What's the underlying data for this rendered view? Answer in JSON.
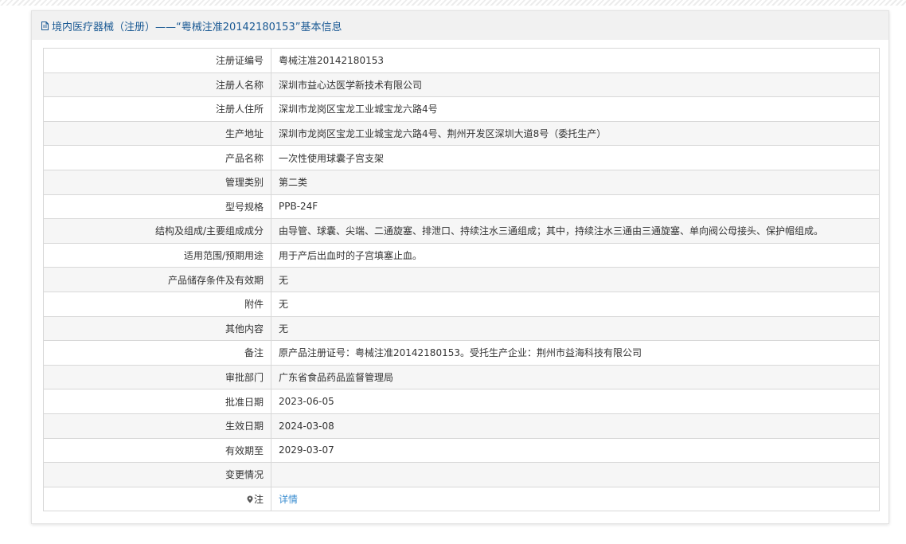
{
  "header": {
    "title": "境内医疗器械（注册）——“粤械注准20142180153”基本信息",
    "icon": "document-icon"
  },
  "rows": [
    {
      "label": "注册证编号",
      "value": "粤械注准20142180153"
    },
    {
      "label": "注册人名称",
      "value": "深圳市益心达医学新技术有限公司"
    },
    {
      "label": "注册人住所",
      "value": "深圳市龙岗区宝龙工业城宝龙六路4号"
    },
    {
      "label": "生产地址",
      "value": "深圳市龙岗区宝龙工业城宝龙六路4号、荆州开发区深圳大道8号（委托生产）"
    },
    {
      "label": "产品名称",
      "value": "一次性使用球囊子宫支架"
    },
    {
      "label": "管理类别",
      "value": "第二类"
    },
    {
      "label": "型号规格",
      "value": "PPB-24F"
    },
    {
      "label": "结构及组成/主要组成成分",
      "value": "由导管、球囊、尖端、二通旋塞、排泄口、持续注水三通组成；其中，持续注水三通由三通旋塞、单向阀公母接头、保护帽组成。"
    },
    {
      "label": "适用范围/预期用途",
      "value": "用于产后出血时的子宫填塞止血。"
    },
    {
      "label": "产品储存条件及有效期",
      "value": "无"
    },
    {
      "label": "附件",
      "value": "无"
    },
    {
      "label": "其他内容",
      "value": "无"
    },
    {
      "label": "备注",
      "value": "原产品注册证号：粤械注准20142180153。受托生产企业：荆州市益海科技有限公司"
    },
    {
      "label": "审批部门",
      "value": "广东省食品药品监督管理局"
    },
    {
      "label": "批准日期",
      "value": "2023-06-05"
    },
    {
      "label": "生效日期",
      "value": "2024-03-08"
    },
    {
      "label": "有效期至",
      "value": "2029-03-07"
    },
    {
      "label": "变更情况",
      "value": ""
    }
  ],
  "note_row": {
    "label": "注",
    "icon": "map-pin-icon",
    "link_text": "详情"
  },
  "colors": {
    "header_text": "#1b5a94",
    "link": "#3a8dd0",
    "border": "#d8d8d8",
    "stripe_row": "#f6f6f6"
  }
}
